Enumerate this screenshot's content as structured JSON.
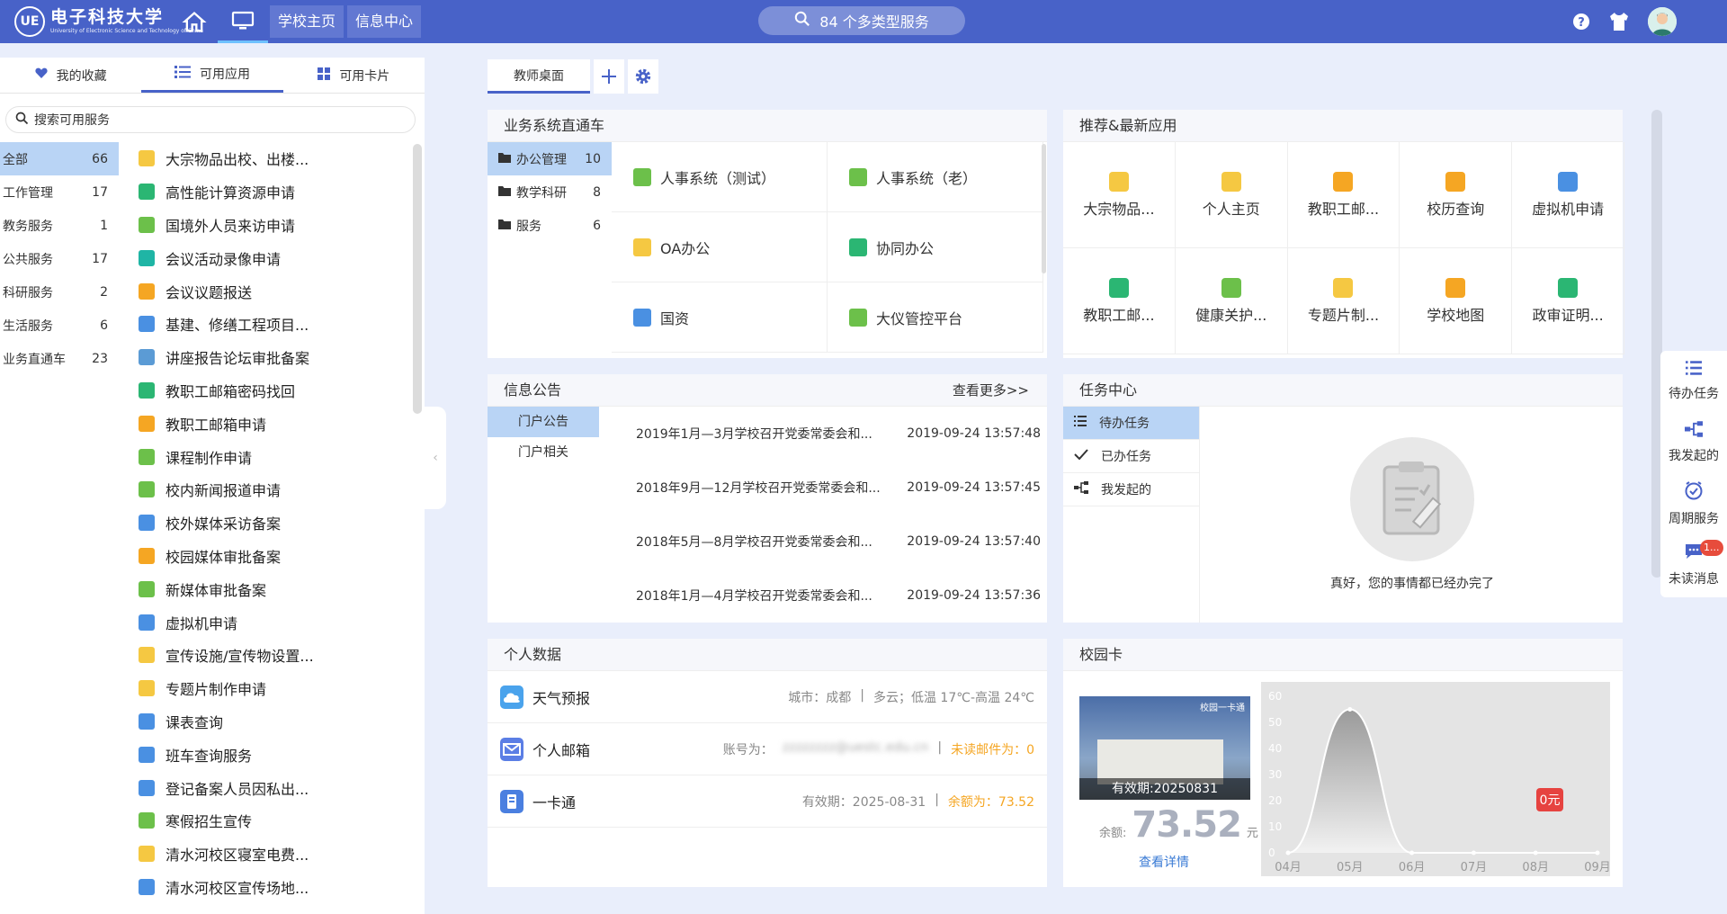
{
  "header": {
    "logo_text": "电子科技大学",
    "logo_subtext": "University of Electronic Science and Technology of China",
    "nav_school_home": "学校主页",
    "nav_info_center": "信息中心",
    "search_label": "84 个多类型服务",
    "icons": [
      "home-icon",
      "desktop-icon",
      "search-icon",
      "help-icon",
      "tshirt-icon",
      "avatar"
    ]
  },
  "left_panel": {
    "tabs": [
      {
        "label": "我的收藏",
        "icon": "heart-icon"
      },
      {
        "label": "可用应用",
        "icon": "list-icon",
        "active": true
      },
      {
        "label": "可用卡片",
        "icon": "grid-icon"
      }
    ],
    "search_placeholder": "搜索可用服务",
    "categories": [
      {
        "label": "全部",
        "count": "66",
        "active": true
      },
      {
        "label": "工作管理",
        "count": "17"
      },
      {
        "label": "教务服务",
        "count": "1"
      },
      {
        "label": "公共服务",
        "count": "17"
      },
      {
        "label": "科研服务",
        "count": "2"
      },
      {
        "label": "生活服务",
        "count": "6"
      },
      {
        "label": "业务直通车",
        "count": "23"
      }
    ],
    "apps": [
      {
        "label": "大宗物品出校、出楼...",
        "color": "#f5c842"
      },
      {
        "label": "高性能计算资源申请",
        "color": "#2bb673"
      },
      {
        "label": "国境外人员来访申请",
        "color": "#6cc04a"
      },
      {
        "label": "会议活动录像申请",
        "color": "#1fb5a5"
      },
      {
        "label": "会议议题报送",
        "color": "#f5a623"
      },
      {
        "label": "基建、修缮工程项目...",
        "color": "#4a90e2"
      },
      {
        "label": "讲座报告论坛审批备案",
        "color": "#5b9bd5"
      },
      {
        "label": "教职工邮箱密码找回",
        "color": "#2bb673"
      },
      {
        "label": "教职工邮箱申请",
        "color": "#f5a623"
      },
      {
        "label": "课程制作申请",
        "color": "#6cc04a"
      },
      {
        "label": "校内新闻报道申请",
        "color": "#6cc04a"
      },
      {
        "label": "校外媒体采访备案",
        "color": "#4a90e2"
      },
      {
        "label": "校园媒体审批备案",
        "color": "#f5a623"
      },
      {
        "label": "新媒体审批备案",
        "color": "#6cc04a"
      },
      {
        "label": "虚拟机申请",
        "color": "#4a90e2"
      },
      {
        "label": "宣传设施/宣传物设置...",
        "color": "#f5c842"
      },
      {
        "label": "专题片制作申请",
        "color": "#f5c842"
      },
      {
        "label": "课表查询",
        "color": "#4a90e2"
      },
      {
        "label": "班车查询服务",
        "color": "#4a90e2"
      },
      {
        "label": "登记备案人员因私出...",
        "color": "#4a90e2"
      },
      {
        "label": "寒假招生宣传",
        "color": "#6cc04a"
      },
      {
        "label": "清水河校区寝室电费...",
        "color": "#f5c842"
      },
      {
        "label": "清水河校区宣传场地...",
        "color": "#4a90e2"
      }
    ]
  },
  "desk_tabs": {
    "active_label": "教师桌面",
    "icons": [
      "plus-icon",
      "gear-icon"
    ]
  },
  "biz_card": {
    "title": "业务系统直通车",
    "categories": [
      {
        "label": "办公管理",
        "count": "10",
        "active": true
      },
      {
        "label": "教学科研",
        "count": "8"
      },
      {
        "label": "服务",
        "count": "6"
      }
    ],
    "items": [
      {
        "label": "人事系统（测试）",
        "color": "#6cc04a"
      },
      {
        "label": "人事系统（老）",
        "color": "#6cc04a"
      },
      {
        "label": "OA办公",
        "color": "#f5c842"
      },
      {
        "label": "协同办公",
        "color": "#2bb673"
      },
      {
        "label": "国资",
        "color": "#4a90e2"
      },
      {
        "label": "大仪管控平台",
        "color": "#6cc04a"
      }
    ]
  },
  "rec_card": {
    "title": "推荐&最新应用",
    "items": [
      {
        "label": "大宗物品...",
        "color": "#f5c842"
      },
      {
        "label": "个人主页",
        "color": "#f5c842"
      },
      {
        "label": "教职工邮...",
        "color": "#f5a623"
      },
      {
        "label": "校历查询",
        "color": "#f5a623"
      },
      {
        "label": "虚拟机申请",
        "color": "#4a90e2"
      },
      {
        "label": "教职工邮...",
        "color": "#2bb673"
      },
      {
        "label": "健康关护...",
        "color": "#6cc04a"
      },
      {
        "label": "专题片制...",
        "color": "#f5c842"
      },
      {
        "label": "学校地图",
        "color": "#f5a623"
      },
      {
        "label": "政审证明...",
        "color": "#2bb673"
      }
    ]
  },
  "notice_card": {
    "title": "信息公告",
    "more": "查看更多>>",
    "tabs": [
      {
        "label": "门户公告",
        "active": true
      },
      {
        "label": "门户相关"
      }
    ],
    "rows": [
      {
        "text": "2019年1月—3月学校召开党委常委会和...",
        "time": "2019-09-24 13:57:48"
      },
      {
        "text": "2018年9月—12月学校召开党委常委会和...",
        "time": "2019-09-24 13:57:45"
      },
      {
        "text": "2018年5月—8月学校召开党委常委会和...",
        "time": "2019-09-24 13:57:40"
      },
      {
        "text": "2018年1月—4月学校召开党委常委会和...",
        "time": "2019-09-24 13:57:36"
      }
    ]
  },
  "task_card": {
    "title": "任务中心",
    "tabs": [
      {
        "label": "待办任务",
        "icon": "todo-icon",
        "active": true
      },
      {
        "label": "已办任务",
        "icon": "check-icon"
      },
      {
        "label": "我发起的",
        "icon": "flow-icon"
      }
    ],
    "empty_text": "真好，您的事情都已经办完了"
  },
  "personal_card": {
    "title": "个人数据",
    "weather": {
      "label": "天气预报",
      "city": "城市：成都",
      "sep": "|",
      "forecast": "多云；低温 17℃-高温 24℃"
    },
    "mail": {
      "label": "个人邮箱",
      "account_label": "账号为：",
      "account_blurred": "zzzzzzzz@uestc.edu.cn",
      "sep": "|",
      "unread": "未读邮件为：0"
    },
    "card": {
      "label": "一卡通",
      "validity": "有效期：2025-08-31",
      "sep": "|",
      "balance": "余额为：73.52"
    }
  },
  "campus_card": {
    "title": "校园卡",
    "card_title": "校园一卡通",
    "expiry": "有效期:20250831",
    "balance_label": "余额:",
    "balance": "73.52",
    "unit": "元",
    "detail": "查看详情",
    "badge": "0元"
  },
  "chart_data": {
    "type": "area",
    "categories": [
      "04月",
      "05月",
      "06月",
      "07月",
      "08月",
      "09月"
    ],
    "values": [
      0,
      55,
      0,
      0,
      0,
      0
    ],
    "ylim": [
      0,
      60
    ],
    "yticks": [
      "60",
      "50",
      "40",
      "30",
      "20",
      "10",
      "0"
    ],
    "annotation": "0元",
    "grid": false
  },
  "side_widget": {
    "items": [
      {
        "label": "待办任务",
        "icon": "todo-icon"
      },
      {
        "label": "我发起的",
        "icon": "flow-icon"
      },
      {
        "label": "周期服务",
        "icon": "clock-check-icon"
      },
      {
        "label": "未读消息",
        "icon": "chat-icon",
        "badge": "1..."
      }
    ]
  }
}
